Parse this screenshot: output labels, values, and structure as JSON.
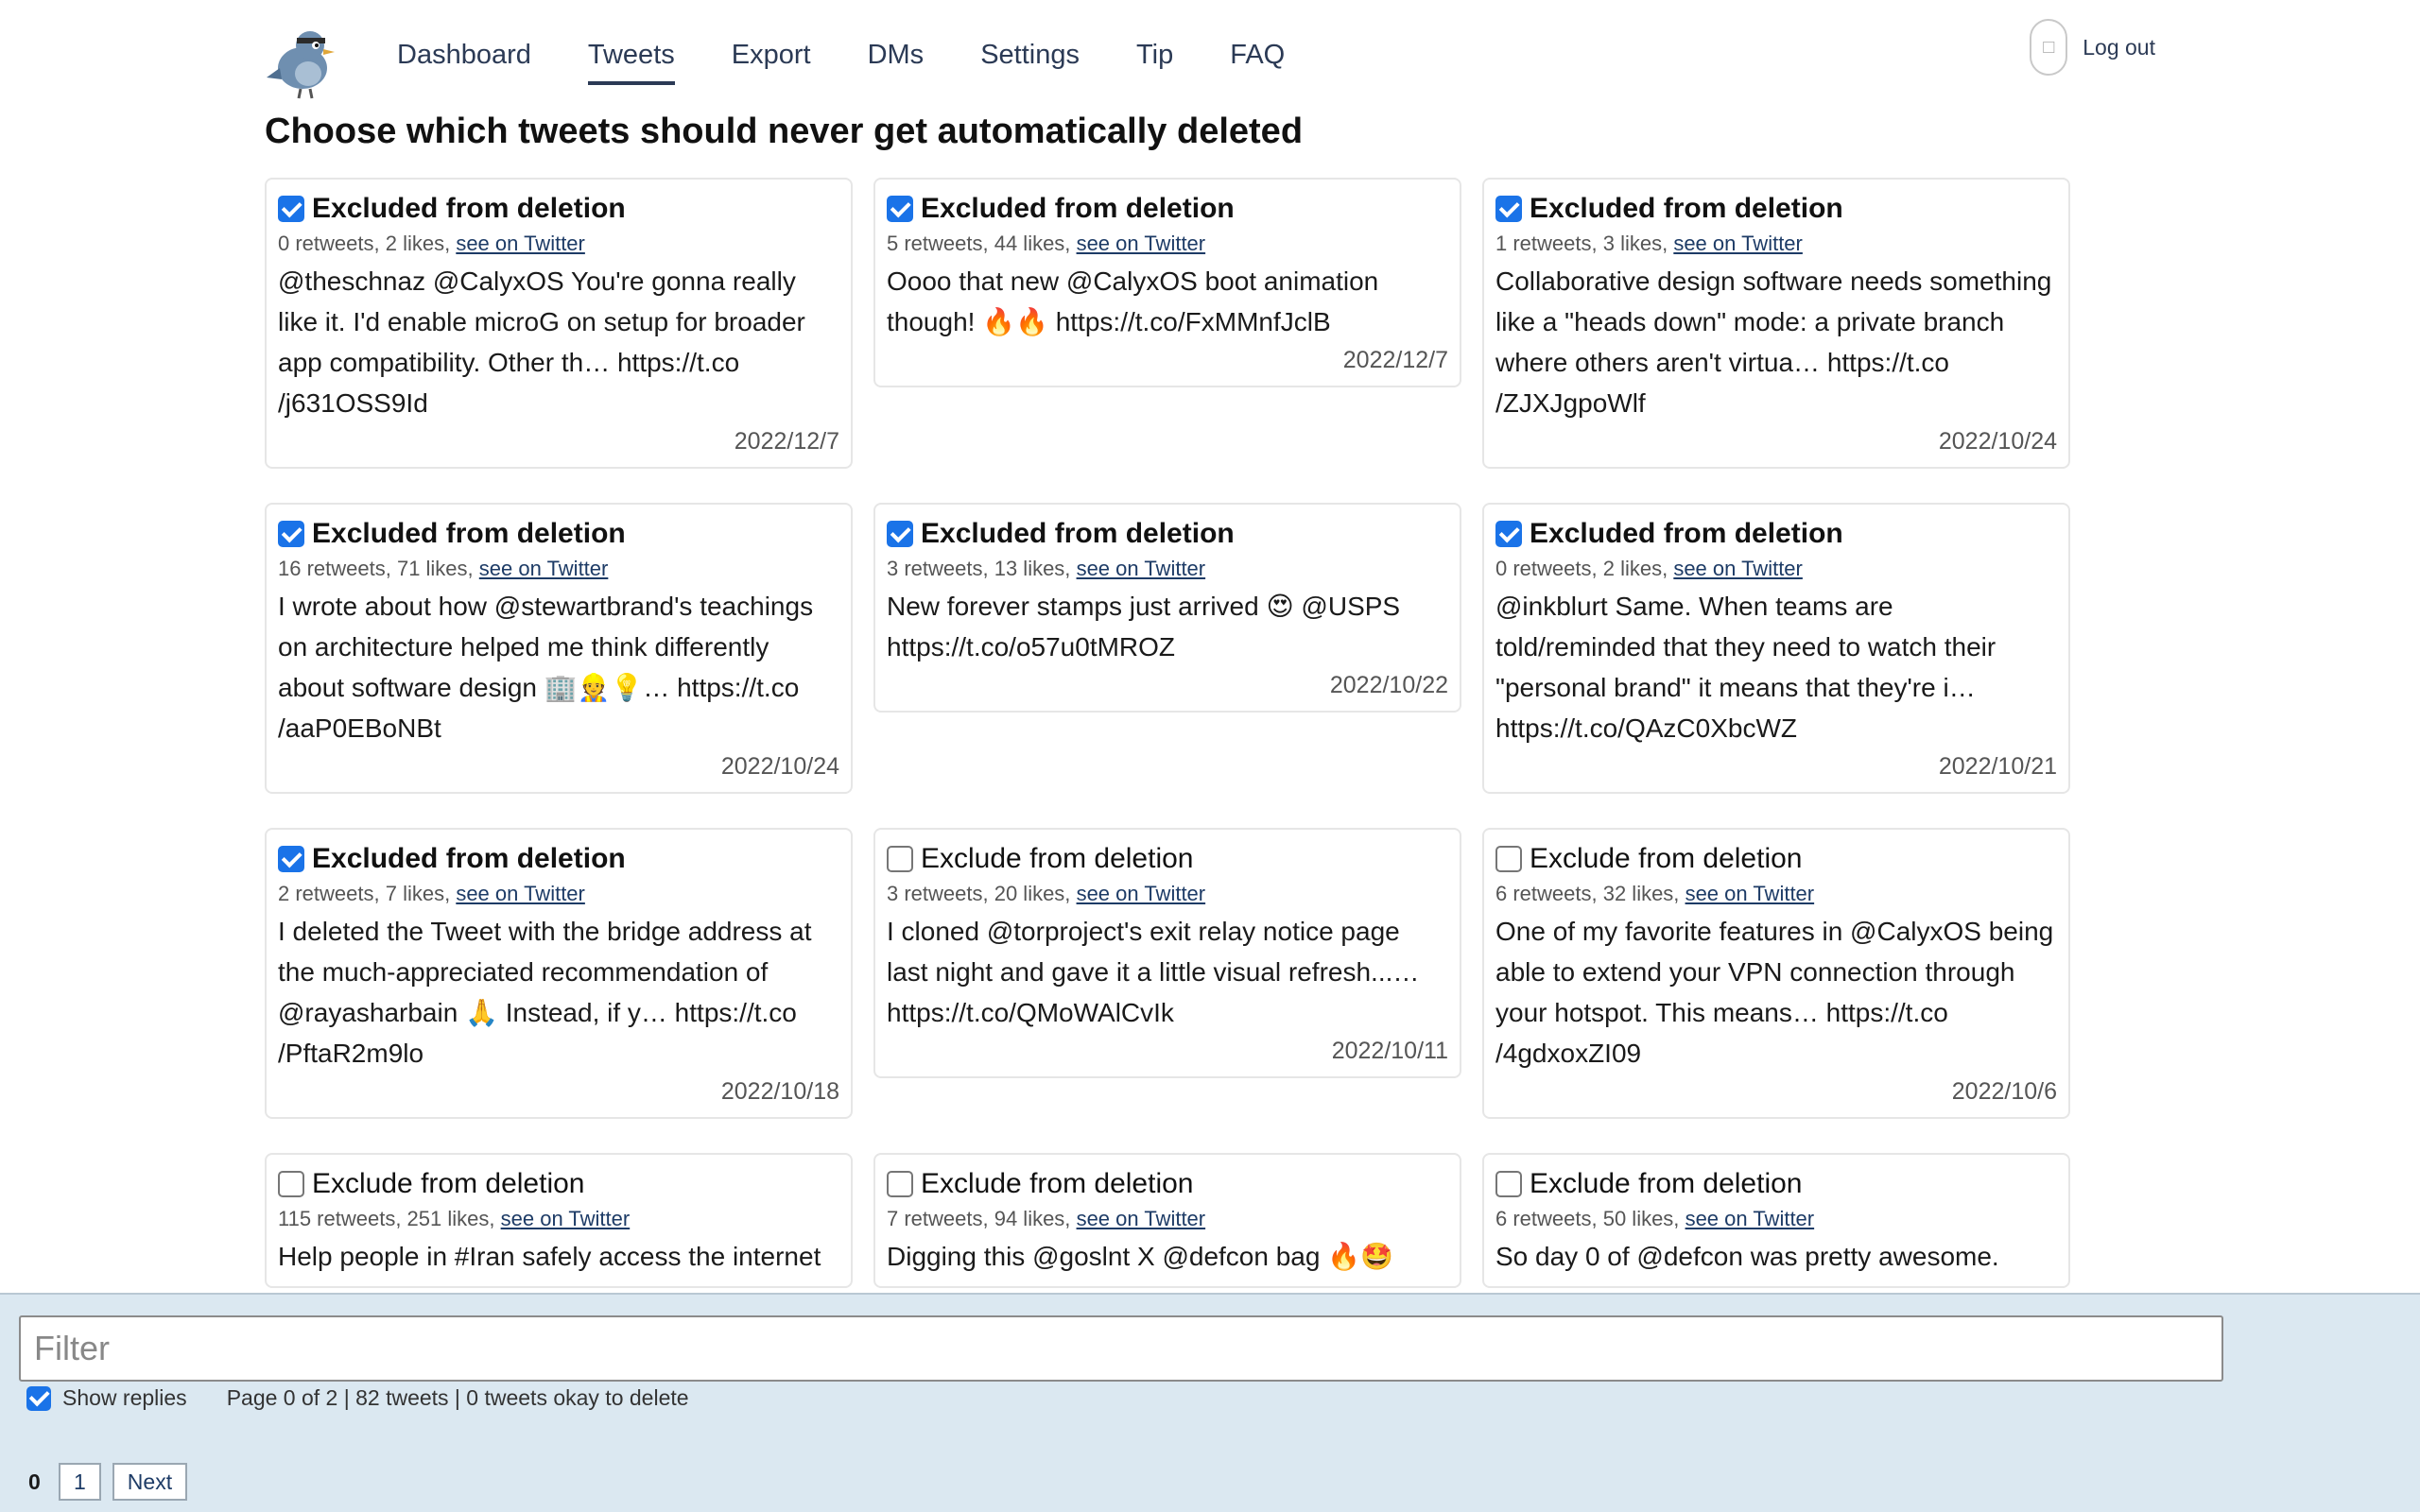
{
  "nav": {
    "items": [
      {
        "label": "Dashboard",
        "active": false
      },
      {
        "label": "Tweets",
        "active": true
      },
      {
        "label": "Export",
        "active": false
      },
      {
        "label": "DMs",
        "active": false
      },
      {
        "label": "Settings",
        "active": false
      },
      {
        "label": "Tip",
        "active": false
      },
      {
        "label": "FAQ",
        "active": false
      }
    ],
    "logout_label": "Log out"
  },
  "page": {
    "title": "Choose which tweets should never get automatically deleted"
  },
  "tweets": [
    {
      "excluded": true,
      "checkbox_label": "Excluded from deletion",
      "retweets_likes": "0 retweets, 2 likes,",
      "link_label": "see on Twitter",
      "text": "@theschnaz @CalyxOS You're gonna really like it. I'd enable microG on setup for broader app compatibility. Other th… https://t.co /j631OSS9Id",
      "date": "2022/12/7"
    },
    {
      "excluded": true,
      "checkbox_label": "Excluded from deletion",
      "retweets_likes": "5 retweets, 44 likes,",
      "link_label": "see on Twitter",
      "text": "Oooo that new @CalyxOS boot animation though! 🔥🔥 https://t.co/FxMMnfJclB",
      "date": "2022/12/7"
    },
    {
      "excluded": true,
      "checkbox_label": "Excluded from deletion",
      "retweets_likes": "1 retweets, 3 likes,",
      "link_label": "see on Twitter",
      "text": "Collaborative design software needs something like a \"heads down\" mode: a private branch where others aren't virtua… https://t.co /ZJXJgpoWlf",
      "date": "2022/10/24"
    },
    {
      "excluded": true,
      "checkbox_label": "Excluded from deletion",
      "retweets_likes": "16 retweets, 71 likes,",
      "link_label": "see on Twitter",
      "text": "I wrote about how @stewartbrand's teachings on architecture helped me think differently about software design 🏢👷💡… https://t.co /aaP0EBoNBt",
      "date": "2022/10/24"
    },
    {
      "excluded": true,
      "checkbox_label": "Excluded from deletion",
      "retweets_likes": "3 retweets, 13 likes,",
      "link_label": "see on Twitter",
      "text": "New forever stamps just arrived 😍 @USPS https://t.co/o57u0tMROZ",
      "date": "2022/10/22"
    },
    {
      "excluded": true,
      "checkbox_label": "Excluded from deletion",
      "retweets_likes": "0 retweets, 2 likes,",
      "link_label": "see on Twitter",
      "text": "@inkblurt Same. When teams are told/reminded that they need to watch their \"personal brand\" it means that they're i… https://t.co/QAzC0XbcWZ",
      "date": "2022/10/21"
    },
    {
      "excluded": true,
      "checkbox_label": "Excluded from deletion",
      "retweets_likes": "2 retweets, 7 likes,",
      "link_label": "see on Twitter",
      "text": "I deleted the Tweet with the bridge address at the much-appreciated recommendation of @rayasharbain 🙏 Instead, if y… https://t.co /PftaR2m9lo",
      "date": "2022/10/18"
    },
    {
      "excluded": false,
      "checkbox_label": "Exclude from deletion",
      "retweets_likes": "3 retweets, 20 likes,",
      "link_label": "see on Twitter",
      "text": "I cloned @torproject's exit relay notice page last night and gave it a little visual refresh...… https://t.co/QMoWAlCvIk",
      "date": "2022/10/11"
    },
    {
      "excluded": false,
      "checkbox_label": "Exclude from deletion",
      "retweets_likes": "6 retweets, 32 likes,",
      "link_label": "see on Twitter",
      "text": "One of my favorite features in @CalyxOS being able to extend your VPN connection through your hotspot. This means… https://t.co /4gdxoxZI09",
      "date": "2022/10/6"
    },
    {
      "excluded": false,
      "checkbox_label": "Exclude from deletion",
      "retweets_likes": "115 retweets, 251 likes,",
      "link_label": "see on Twitter",
      "text": "Help people in #Iran safely access the internet",
      "date": ""
    },
    {
      "excluded": false,
      "checkbox_label": "Exclude from deletion",
      "retweets_likes": "7 retweets, 94 likes,",
      "link_label": "see on Twitter",
      "text": "Digging this @goslnt X @defcon bag 🔥🤩",
      "date": ""
    },
    {
      "excluded": false,
      "checkbox_label": "Exclude from deletion",
      "retweets_likes": "6 retweets, 50 likes,",
      "link_label": "see on Twitter",
      "text": "So day 0 of @defcon was pretty awesome.",
      "date": ""
    }
  ],
  "footer": {
    "filter_placeholder": "Filter",
    "show_replies_label": "Show replies",
    "show_replies_checked": true,
    "status_text": "Page 0 of 2 | 82 tweets | 0 tweets okay to delete",
    "current_page": "0",
    "page_link": "1",
    "next_label": "Next"
  },
  "colors": {
    "accent": "#1a73e8",
    "nav_text": "#2b3a55",
    "footer_bg": "#dbe8f1"
  },
  "icons": {
    "logo": "bird-logo-icon",
    "avatar": "user-avatar-icon"
  }
}
